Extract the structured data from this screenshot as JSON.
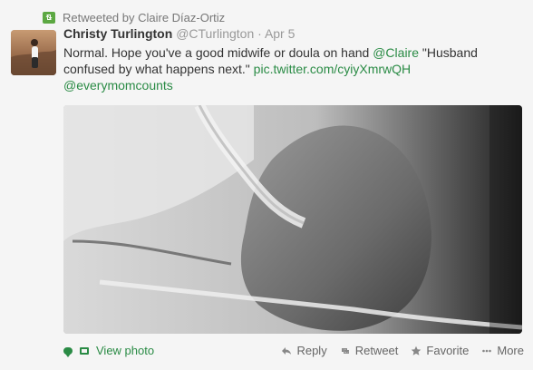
{
  "retweet": {
    "label": "Retweeted by Claire Díaz-Ortiz",
    "accent": "#5ca842"
  },
  "tweet": {
    "name": "Christy Turlington",
    "handle": "@CTurlington",
    "separator": "·",
    "time": "Apr 5",
    "text_parts": {
      "p1": "Normal. Hope you've a good midwife or doula on hand ",
      "mention": "@Claire",
      "p2": " \"Husband confused by what happens next.\" ",
      "link": "pic.twitter.com/cyiyXmrwQH",
      "p3": " ",
      "hashtag": "@everymomcounts"
    },
    "link_color": "#2a8b45"
  },
  "footer": {
    "view_photo": "View photo",
    "actions": {
      "reply": "Reply",
      "retweet": "Retweet",
      "favorite": "Favorite",
      "more": "More"
    }
  }
}
